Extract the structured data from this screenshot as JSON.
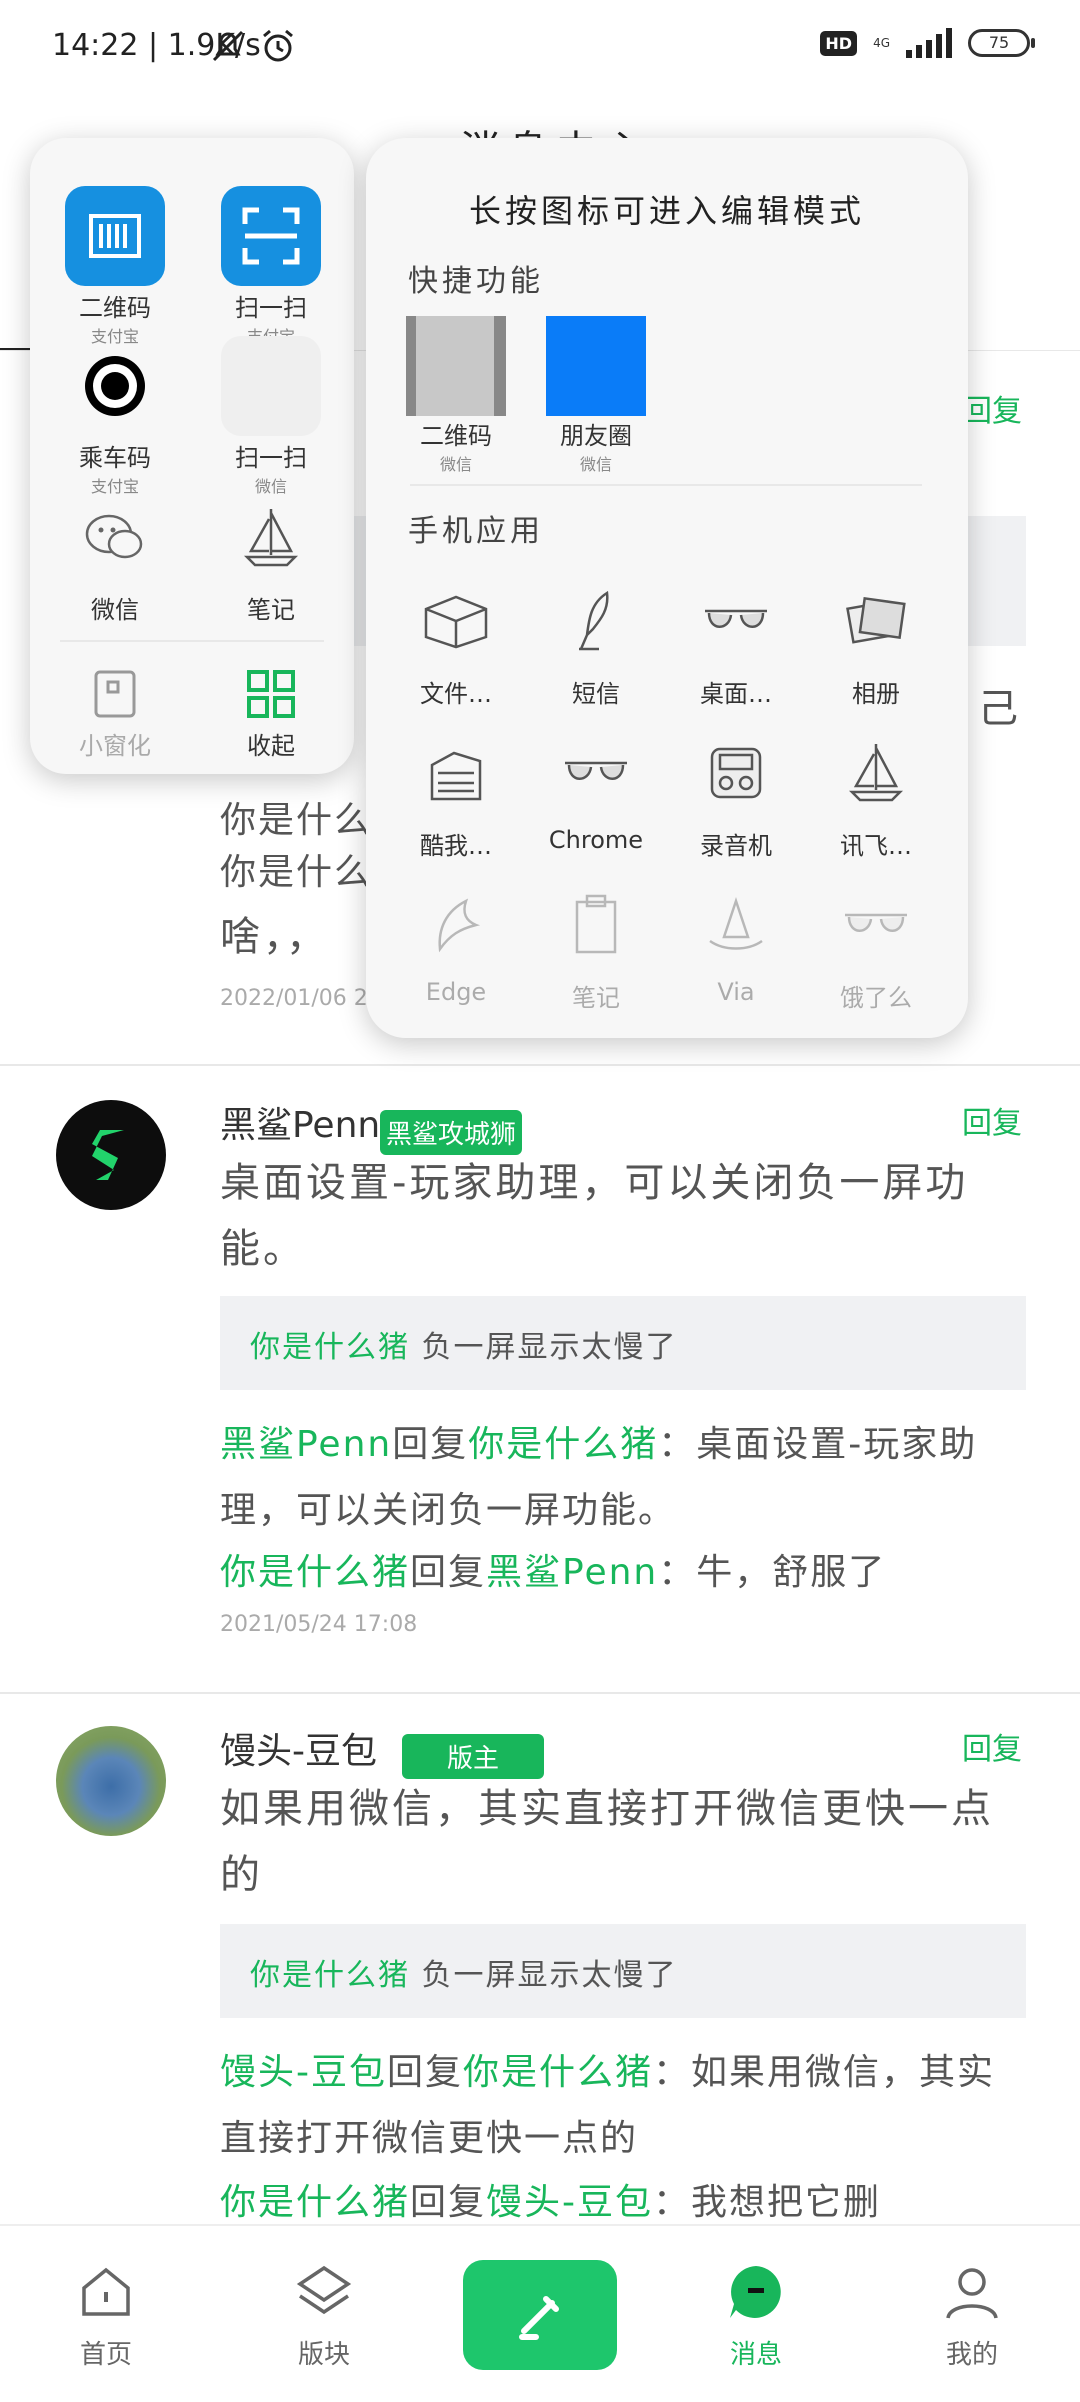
{
  "status_bar": {
    "time": "14:22 | 1.9K/s",
    "hd": "HD",
    "net": "4G",
    "battery": "75"
  },
  "page_title": "消息中心",
  "comments": [
    {
      "date": "2022/01/06 23"
    },
    {
      "author": "黑鲨Penn",
      "badge": "黑鲨攻城狮",
      "reply": "回复",
      "content": "桌面设置-玩家助理，可以关闭负一屏功能。",
      "quote_user": "你是什么猪",
      "quote_text": "负一屏显示太慢了",
      "sub1_user": "黑鲨Penn",
      "sub1_mid": "回复",
      "sub1_target": "你是什么猪",
      "sub1_text": "：桌面设置-玩家助理，可以关闭负一屏功能。",
      "sub2_user": "你是什么猪",
      "sub2_mid": "回复",
      "sub2_target": "黑鲨Penn",
      "sub2_text": "：牛，舒服了",
      "date": "2021/05/24 17:08"
    },
    {
      "author": "馒头-豆包",
      "badge": "版主",
      "reply": "回复",
      "content": "如果用微信，其实直接打开微信更快一点的",
      "quote_user": "你是什么猪",
      "quote_text": "负一屏显示太慢了",
      "sub1_user": "馒头-豆包",
      "sub1_mid": "回复",
      "sub1_target": "你是什么猪",
      "sub1_text": "：如果用微信，其实直接打开微信更快一点的",
      "sub2_user": "你是什么猪",
      "sub2_mid": "回复",
      "sub2_target": "馒头-豆包",
      "sub2_text": "：我想把它删"
    }
  ],
  "first_comment_partial": {
    "reply": "回复",
    "line_a": "你是什么",
    "line_b": "你是什么",
    "line_c": "啥，，",
    "tail": "己"
  },
  "popup_left": {
    "items": [
      {
        "label": "二维码",
        "sub": "支付宝",
        "icon": "qr-code-icon"
      },
      {
        "label": "扫一扫",
        "sub": "支付宝",
        "icon": "scan-icon"
      },
      {
        "label": "乘车码",
        "sub": "支付宝",
        "icon": "bus-code-icon"
      },
      {
        "label": "扫一扫",
        "sub": "微信",
        "icon": "scan-icon"
      },
      {
        "label": "微信",
        "icon": "wechat-icon"
      },
      {
        "label": "笔记",
        "icon": "sailboat-icon"
      }
    ],
    "mini_window": "小窗化",
    "collapse": "收起"
  },
  "popup_right": {
    "title": "长按图标可进入编辑模式",
    "section_shortcuts": "快捷功能",
    "shortcuts": [
      {
        "label": "二维码",
        "sub": "微信"
      },
      {
        "label": "朋友圈",
        "sub": "微信"
      }
    ],
    "section_apps": "手机应用",
    "apps": [
      "文件…",
      "短信",
      "桌面…",
      "相册",
      "酷我…",
      "Chrome",
      "录音机",
      "讯飞…",
      "Edge",
      "笔记",
      "Via",
      "饿了么"
    ]
  },
  "nav": {
    "home": "首页",
    "boards": "版块",
    "messages": "消息",
    "me": "我的"
  },
  "colors": {
    "accent": "#18b65b",
    "blue": "#1690e0"
  }
}
